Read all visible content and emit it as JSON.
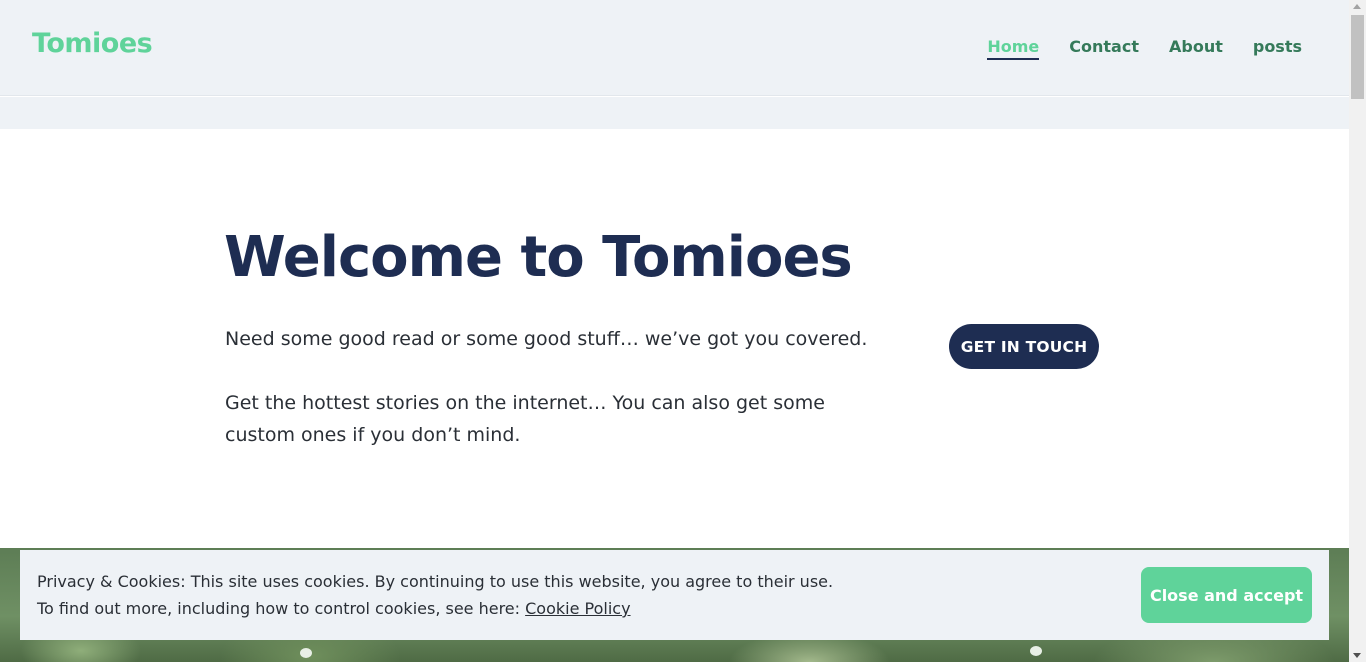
{
  "header": {
    "site_title": "Tomioes",
    "nav": [
      {
        "label": "Home",
        "active": true
      },
      {
        "label": "Contact",
        "active": false
      },
      {
        "label": "About",
        "active": false
      },
      {
        "label": "posts",
        "active": false
      }
    ]
  },
  "hero": {
    "title": "Welcome to Tomioes",
    "paragraph_1": "Need some good read or some good stuff… we’ve got you covered.",
    "paragraph_2": "Get the hottest stories on the internet… You can also get some custom ones if you don’t mind.",
    "cta_label": "GET IN TOUCH"
  },
  "cookie_banner": {
    "line_1": "Privacy & Cookies: This site uses cookies. By continuing to use this website, you agree to their use.",
    "line_2_prefix": "To find out more, including how to control cookies, see here: ",
    "policy_link": "Cookie Policy",
    "accept_label": "Close and accept"
  },
  "colors": {
    "brand_green": "#5fd39a",
    "nav_green": "#357a5a",
    "navy": "#1e2d52",
    "header_bg": "#eef2f6"
  }
}
